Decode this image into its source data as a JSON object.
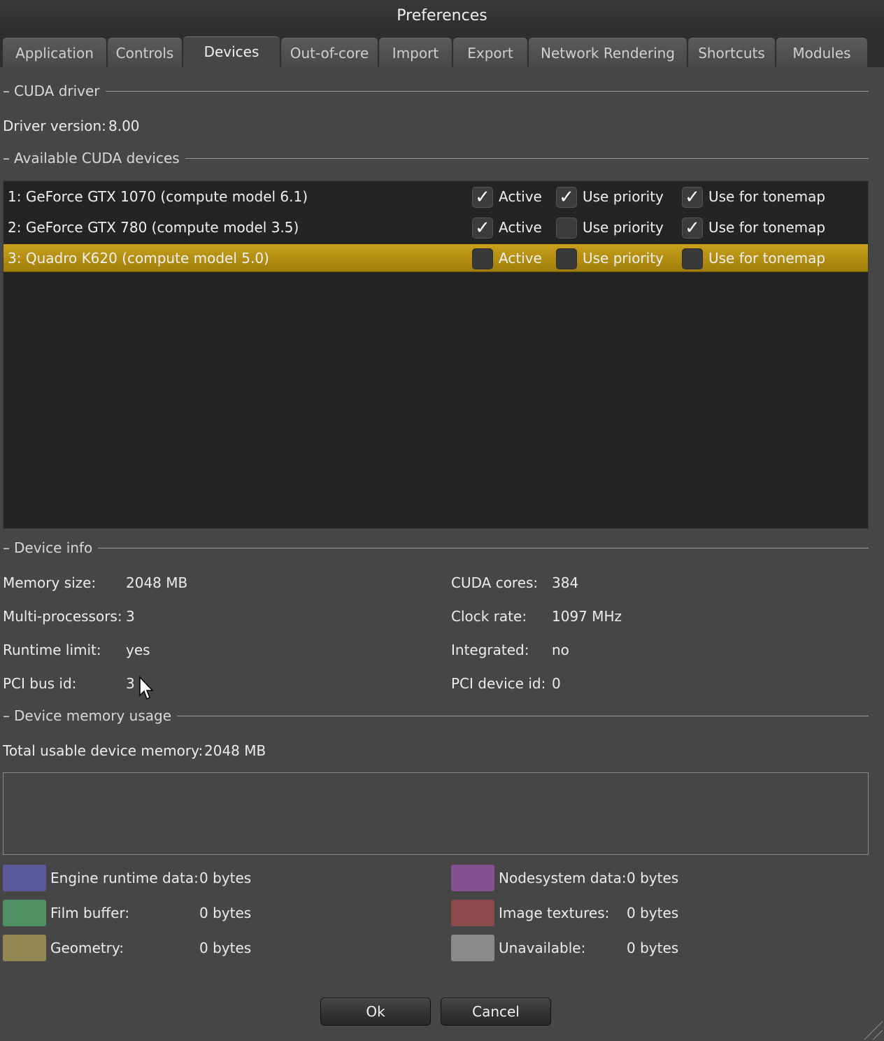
{
  "window": {
    "title": "Preferences"
  },
  "tabs": [
    "Application",
    "Controls",
    "Devices",
    "Out-of-core",
    "Import",
    "Export",
    "Network Rendering",
    "Shortcuts",
    "Modules"
  ],
  "active_tab": "Devices",
  "cuda_driver": {
    "heading": "CUDA driver",
    "driver_version_label": "Driver version:",
    "driver_version": "8.00"
  },
  "devices": {
    "heading": "Available CUDA devices",
    "labels": {
      "active": "Active",
      "use_priority": "Use priority",
      "use_for_tonemap": "Use for tonemap"
    },
    "items": [
      {
        "name": "1: GeForce GTX 1070 (compute model 6.1)",
        "active": true,
        "use_priority": true,
        "use_for_tonemap": true,
        "selected": false
      },
      {
        "name": "2: GeForce GTX 780 (compute model 3.5)",
        "active": true,
        "use_priority": false,
        "use_for_tonemap": true,
        "selected": false
      },
      {
        "name": "3: Quadro K620 (compute model 5.0)",
        "active": false,
        "use_priority": false,
        "use_for_tonemap": false,
        "selected": true
      }
    ],
    "check_glyph": "✓"
  },
  "device_info": {
    "heading": "Device info",
    "memory_size_label": "Memory size:",
    "memory_size": "2048 MB",
    "multi_processors_label": "Multi-processors:",
    "multi_processors": "3",
    "runtime_limit_label": "Runtime limit:",
    "runtime_limit": "yes",
    "pci_bus_id_label": "PCI bus id:",
    "pci_bus_id": "3",
    "cuda_cores_label": "CUDA cores:",
    "cuda_cores": "384",
    "clock_rate_label": "Clock rate:",
    "clock_rate": "1097 MHz",
    "integrated_label": "Integrated:",
    "integrated": "no",
    "pci_device_id_label": "PCI device id:",
    "pci_device_id": "0"
  },
  "memory_usage": {
    "heading": "Device memory usage",
    "total_label": "Total usable device memory:",
    "total": "2048 MB",
    "legend": [
      {
        "label": "Engine runtime data:",
        "value": "0 bytes",
        "color": "#5a5a9c"
      },
      {
        "label": "Film buffer:",
        "value": "0 bytes",
        "color": "#4f9163"
      },
      {
        "label": "Geometry:",
        "value": "0 bytes",
        "color": "#958754"
      },
      {
        "label": "Nodesystem data:",
        "value": "0 bytes",
        "color": "#85508f"
      },
      {
        "label": "Image textures:",
        "value": "0 bytes",
        "color": "#8c4a4a"
      },
      {
        "label": "Unavailable:",
        "value": "0 bytes",
        "color": "#8a8a8a"
      }
    ]
  },
  "buttons": {
    "ok": "Ok",
    "cancel": "Cancel"
  }
}
